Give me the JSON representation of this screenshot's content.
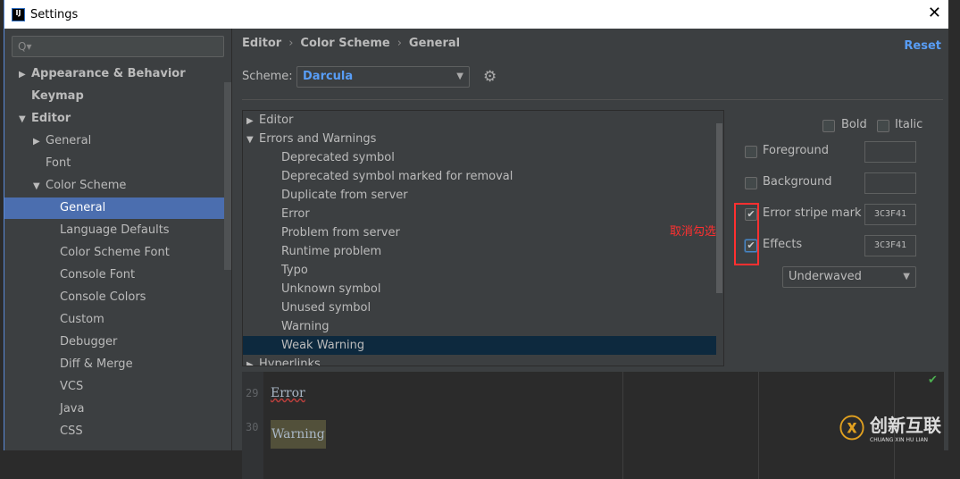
{
  "window": {
    "title": "Settings",
    "logo": "IJ",
    "close": "✕"
  },
  "sidebar": {
    "search_placeholder": "Q▾",
    "items": [
      {
        "label": "Appearance & Behavior",
        "arrow": "▶",
        "bold": true,
        "indent": 0
      },
      {
        "label": "Keymap",
        "arrow": "",
        "bold": true,
        "indent": 0
      },
      {
        "label": "Editor",
        "arrow": "▼",
        "bold": true,
        "indent": 0
      },
      {
        "label": "General",
        "arrow": "▶",
        "bold": false,
        "indent": 1
      },
      {
        "label": "Font",
        "arrow": "",
        "bold": false,
        "indent": 1
      },
      {
        "label": "Color Scheme",
        "arrow": "▼",
        "bold": false,
        "indent": 1
      },
      {
        "label": "General",
        "arrow": "",
        "bold": false,
        "indent": 2,
        "selected": true
      },
      {
        "label": "Language Defaults",
        "arrow": "",
        "bold": false,
        "indent": 2
      },
      {
        "label": "Color Scheme Font",
        "arrow": "",
        "bold": false,
        "indent": 2
      },
      {
        "label": "Console Font",
        "arrow": "",
        "bold": false,
        "indent": 2
      },
      {
        "label": "Console Colors",
        "arrow": "",
        "bold": false,
        "indent": 2
      },
      {
        "label": "Custom",
        "arrow": "",
        "bold": false,
        "indent": 2
      },
      {
        "label": "Debugger",
        "arrow": "",
        "bold": false,
        "indent": 2
      },
      {
        "label": "Diff & Merge",
        "arrow": "",
        "bold": false,
        "indent": 2
      },
      {
        "label": "VCS",
        "arrow": "",
        "bold": false,
        "indent": 2
      },
      {
        "label": "Java",
        "arrow": "",
        "bold": false,
        "indent": 2
      },
      {
        "label": "CSS",
        "arrow": "",
        "bold": false,
        "indent": 2
      }
    ]
  },
  "breadcrumb": [
    "Editor",
    "Color Scheme",
    "General"
  ],
  "breadcrumb_sep": "›",
  "reset_label": "Reset",
  "scheme": {
    "label": "Scheme:",
    "value": "Darcula"
  },
  "tree": [
    {
      "label": "Editor",
      "arrow": "▶",
      "indent": 0
    },
    {
      "label": "Errors and Warnings",
      "arrow": "▼",
      "indent": 0
    },
    {
      "label": "Deprecated symbol",
      "indent": 1
    },
    {
      "label": "Deprecated symbol marked for removal",
      "indent": 1
    },
    {
      "label": "Duplicate from server",
      "indent": 1
    },
    {
      "label": "Error",
      "indent": 1
    },
    {
      "label": "Problem from server",
      "indent": 1
    },
    {
      "label": "Runtime problem",
      "indent": 1
    },
    {
      "label": "Typo",
      "indent": 1
    },
    {
      "label": "Unknown symbol",
      "indent": 1
    },
    {
      "label": "Unused symbol",
      "indent": 1
    },
    {
      "label": "Warning",
      "indent": 1
    },
    {
      "label": "Weak Warning",
      "indent": 1,
      "selected": true
    },
    {
      "label": "Hyperlinks",
      "arrow": "▶",
      "indent": 0
    }
  ],
  "attributes": {
    "bold": "Bold",
    "italic": "Italic",
    "foreground": "Foreground",
    "background": "Background",
    "error_stripe": "Error stripe mark",
    "error_stripe_color": "3C3F41",
    "error_stripe_checked": true,
    "effects": "Effects",
    "effects_color": "3C3F41",
    "effects_checked": true,
    "effect_type": "Underwaved"
  },
  "annotation": "取消勾选",
  "preview": {
    "lines": [
      {
        "num": "29",
        "text": "Error"
      },
      {
        "num": "30",
        "text": "Warning"
      }
    ]
  },
  "watermark": {
    "name": "创新互联",
    "sub": "CHUANG XIN HU LIAN"
  },
  "colors": {
    "accent": "#589df6",
    "selection": "#4b6eaf",
    "annotation": "#ff3030"
  }
}
